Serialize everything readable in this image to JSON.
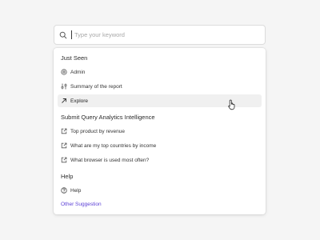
{
  "search": {
    "placeholder": "Type your keyword",
    "value": ""
  },
  "sections": [
    {
      "title": "Just Seen",
      "items": [
        {
          "label": "Admin",
          "icon": "gear-icon"
        },
        {
          "label": "Summary of the report",
          "icon": "sliders-icon"
        },
        {
          "label": "Explore",
          "icon": "arrow-up-right-icon",
          "active": true
        }
      ]
    },
    {
      "title": "Submit Query Analytics Intelligence",
      "items": [
        {
          "label": "Top product by revenue",
          "icon": "external-link-icon"
        },
        {
          "label": "What are my top countries by income",
          "icon": "external-link-icon"
        },
        {
          "label": "What browser is  used most often?",
          "icon": "external-link-icon"
        }
      ]
    },
    {
      "title": "Help",
      "items": [
        {
          "label": "Help",
          "icon": "help-circle-icon"
        }
      ]
    }
  ],
  "other_suggestion": "Other Suggestion",
  "colors": {
    "accent": "#5b3fd6",
    "active_row": "#f0f0f0",
    "background": "#f5f5f5"
  }
}
